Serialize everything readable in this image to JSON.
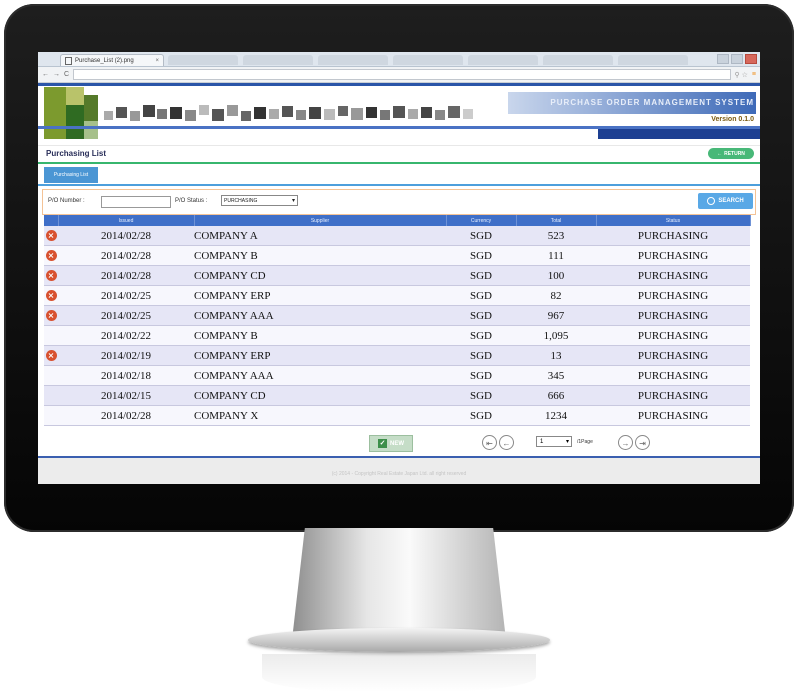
{
  "browser": {
    "tab_title": "Purchase_List (2).png",
    "tab_close": "×",
    "nav_back": "←",
    "nav_forward": "→",
    "nav_reload": "C",
    "tools": "⚲ ☆",
    "menu": "≡"
  },
  "header": {
    "system_title": "PURCHASE ORDER MANAGEMENT SYSTEM",
    "version": "Version 0.1.0"
  },
  "page": {
    "title": "Purchasing List",
    "return_label": "RETURN",
    "tab_label": "Purchasing List"
  },
  "search": {
    "po_number_label": "P/O Number :",
    "po_number_value": "",
    "status_label": "P/O Status :",
    "status_value": "PURCHASING",
    "search_label": "SEARCH"
  },
  "table": {
    "columns": [
      "Issued",
      "Supplier",
      "Currency",
      "Total",
      "Status"
    ],
    "rows": [
      {
        "deletable": true,
        "issued": "2014/02/28",
        "supplier": "COMPANY A",
        "currency": "SGD",
        "total": "523",
        "status": "PURCHASING"
      },
      {
        "deletable": true,
        "issued": "2014/02/28",
        "supplier": "COMPANY B",
        "currency": "SGD",
        "total": "111",
        "status": "PURCHASING"
      },
      {
        "deletable": true,
        "issued": "2014/02/28",
        "supplier": "COMPANY CD",
        "currency": "SGD",
        "total": "100",
        "status": "PURCHASING"
      },
      {
        "deletable": true,
        "issued": "2014/02/25",
        "supplier": "COMPANY ERP",
        "currency": "SGD",
        "total": "82",
        "status": "PURCHASING"
      },
      {
        "deletable": true,
        "issued": "2014/02/25",
        "supplier": "COMPANY AAA",
        "currency": "SGD",
        "total": "967",
        "status": "PURCHASING"
      },
      {
        "deletable": false,
        "issued": "2014/02/22",
        "supplier": "COMPANY B",
        "currency": "SGD",
        "total": "1,095",
        "status": "PURCHASING"
      },
      {
        "deletable": true,
        "issued": "2014/02/19",
        "supplier": "COMPANY ERP",
        "currency": "SGD",
        "total": "13",
        "status": "PURCHASING"
      },
      {
        "deletable": false,
        "issued": "2014/02/18",
        "supplier": "COMPANY AAA",
        "currency": "SGD",
        "total": "345",
        "status": "PURCHASING"
      },
      {
        "deletable": false,
        "issued": "2014/02/15",
        "supplier": "COMPANY CD",
        "currency": "SGD",
        "total": "666",
        "status": "PURCHASING"
      },
      {
        "deletable": false,
        "issued": "2014/02/28",
        "supplier": "COMPANY X",
        "currency": "SGD",
        "total": "1234",
        "status": "PURCHASING"
      }
    ],
    "delete_icon": "×"
  },
  "pager": {
    "new_label": "NEW",
    "first_icon": "⇤",
    "prev_icon": "←",
    "page_value": "1",
    "per_page_label": "/1Page",
    "next_icon": "→",
    "last_icon": "⇥"
  },
  "footer": {
    "copyright": "(c) 2014 - Copyright Real Estate Japan Ltd. all right reserved"
  },
  "colors": {
    "header_blue": "#3f6fc8",
    "accent_green": "#48b878",
    "delete_red": "#d8512f",
    "search_blue": "#59a8e6"
  }
}
